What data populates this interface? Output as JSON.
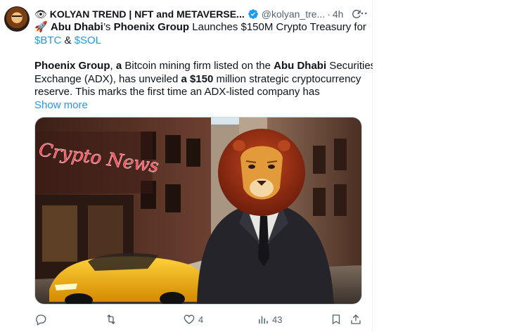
{
  "tweet": {
    "emoji_prefix": "👁",
    "display_name": "KOLYAN TREND | NFT and METAVERSE...",
    "handle": "@kolyan_tre...",
    "separator": "·",
    "time": "4h",
    "more_icon": "more-dots-icon",
    "verified_icon": "verified-badge-icon",
    "grok_icon": "grok-icon",
    "line1": {
      "rocket": "🚀",
      "bold1": "Abu Dhabi",
      "t1": "’s ",
      "bold2": "Phoenix Group",
      "t2": " Launches $150M Crypto Treasury for"
    },
    "line2": {
      "cash1": "$BTC",
      "t1": " & ",
      "cash2": "$SOL"
    },
    "para": {
      "bold1": "Phoenix Group",
      "t1": ", ",
      "bold2": "a",
      "t2": " Bitcoin mining firm listed on the ",
      "bold3": "Abu Dhabi",
      "t3": " Securities",
      "l2": "Exchange (ADX), has unveiled ",
      "bold4": "a $150",
      "t4": " million strategic cryptocurrency",
      "l3": "reserve. This marks the first time an ADX-listed company has"
    },
    "show_more": "Show more",
    "image": {
      "neon_sign": "Crypto News"
    },
    "actions": {
      "reply_count": "",
      "retweet_count": "",
      "like_count": "4",
      "views_count": "43"
    }
  },
  "colors": {
    "link": "#1d9bf0",
    "muted": "#536471",
    "verified": "#1d9bf0"
  }
}
